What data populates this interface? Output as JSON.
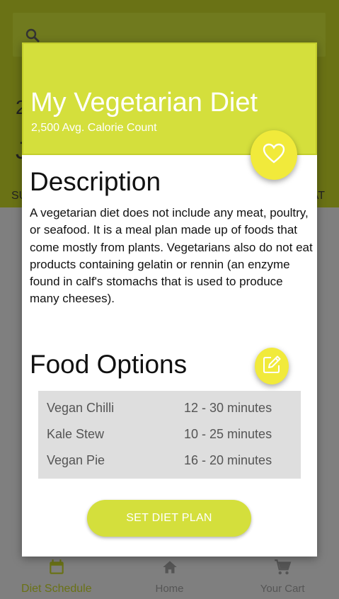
{
  "background": {
    "calendar_year": "2",
    "calendar_month": "J",
    "weekday_first": "SU",
    "weekday_last": "AT"
  },
  "dialog": {
    "title": "My Vegetarian Diet",
    "subtitle": "2,500 Avg. Calorie Count",
    "description_heading": "Description",
    "description_text": "A vegetarian diet does not include any meat, poultry, or seafood. It is a meal plan made up of foods that come mostly from plants. Vegetarians also do not eat products containing gelatin or rennin (an enzyme found in calf's stomachs that is used to produce many cheeses).",
    "food_heading": "Food Options",
    "foods": [
      {
        "name": "Vegan Chilli",
        "time": "12 - 30 minutes"
      },
      {
        "name": "Kale Stew",
        "time": "10 - 25 minutes"
      },
      {
        "name": "Vegan Pie",
        "time": "16 - 20 minutes"
      }
    ],
    "set_button": "SET DIET PLAN"
  },
  "nav": {
    "schedule": "Diet Schedule",
    "home": "Home",
    "cart": "Your Cart"
  },
  "colors": {
    "accent": "#d4df3c",
    "fab": "#f1ea3b",
    "scrim": "#7f7f7f"
  },
  "icons": [
    "search-icon",
    "heart-icon",
    "edit-icon",
    "calendar-icon",
    "home-icon",
    "cart-icon"
  ]
}
